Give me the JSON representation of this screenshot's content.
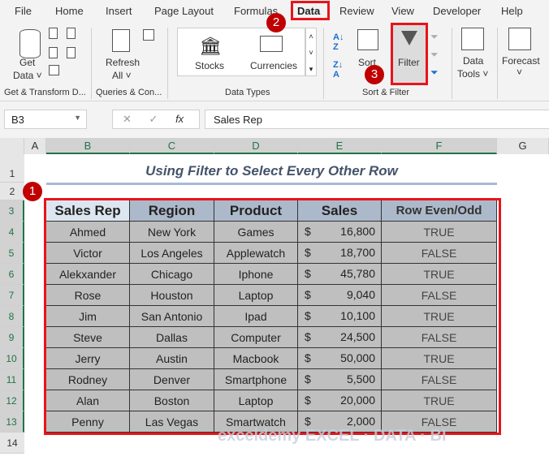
{
  "ribbon_tabs": [
    "File",
    "Home",
    "Insert",
    "Page Layout",
    "Formulas",
    "Data",
    "Review",
    "View",
    "Developer",
    "Help"
  ],
  "active_tab": "Data",
  "ribbon": {
    "get_data": "Get",
    "get_data2": "Data ˅",
    "refresh": "Refresh",
    "refresh2": "All ˅",
    "stocks": "Stocks",
    "currencies": "Currencies",
    "sort": "Sort",
    "filter": "Filter",
    "data_tools": "Data",
    "data_tools2": "Tools ˅",
    "forecast": "Forecast",
    "forecast2": "˅",
    "groups": [
      "Get & Transform D...",
      "Queries & Con...",
      "Data Types",
      "Sort & Filter"
    ]
  },
  "formula_bar": {
    "name_box": "B3",
    "fx": "fx",
    "content": "Sales Rep",
    "cancel": "✕",
    "enter": "✓"
  },
  "columns": [
    "A",
    "B",
    "C",
    "D",
    "E",
    "F",
    "G"
  ],
  "rows": [
    "1",
    "2",
    "3",
    "4",
    "5",
    "6",
    "7",
    "8",
    "9",
    "10",
    "11",
    "12",
    "13",
    "14"
  ],
  "title": "Using Filter to Select Every Other Row",
  "table": {
    "headers": [
      "Sales Rep",
      "Region",
      "Product",
      "Sales",
      "Row Even/Odd"
    ],
    "rows": [
      [
        "Ahmed",
        "New York",
        "Games",
        "$",
        "16,800",
        "TRUE"
      ],
      [
        "Victor",
        "Los Angeles",
        "Applewatch",
        "$",
        "18,700",
        "FALSE"
      ],
      [
        "Alekxander",
        "Chicago",
        "Iphone",
        "$",
        "45,780",
        "TRUE"
      ],
      [
        "Rose",
        "Houston",
        "Laptop",
        "$",
        "9,040",
        "FALSE"
      ],
      [
        "Jim",
        "San Antonio",
        "Ipad",
        "$",
        "10,100",
        "TRUE"
      ],
      [
        "Steve",
        "Dallas",
        "Computer",
        "$",
        "24,500",
        "FALSE"
      ],
      [
        "Jerry",
        "Austin",
        "Macbook",
        "$",
        "50,000",
        "TRUE"
      ],
      [
        "Rodney",
        "Denver",
        "Smartphone",
        "$",
        "5,500",
        "FALSE"
      ],
      [
        "Alan",
        "Boston",
        "Laptop",
        "$",
        "20,000",
        "TRUE"
      ],
      [
        "Penny",
        "Las Vegas",
        "Smartwatch",
        "$",
        "2,000",
        "FALSE"
      ]
    ]
  },
  "badges": [
    "1",
    "2",
    "3"
  ],
  "watermark": "exceldemy EXCEL · DATA · BI",
  "colors": {
    "accent": "#217346",
    "highlight": "#e8141b",
    "badge": "#c00000"
  }
}
